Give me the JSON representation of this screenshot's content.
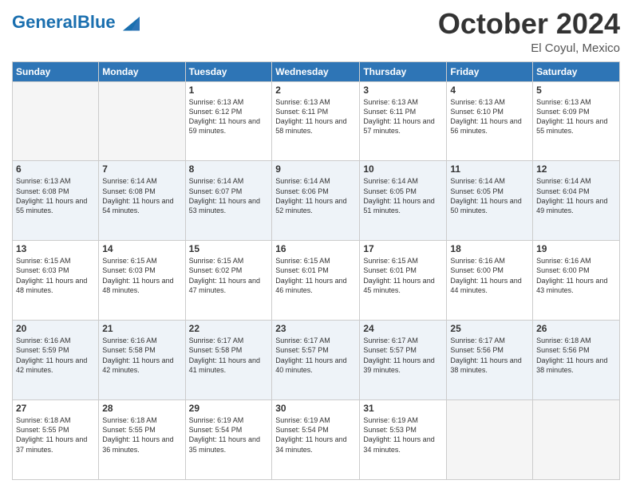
{
  "header": {
    "logo_text_general": "General",
    "logo_text_blue": "Blue",
    "month_title": "October 2024",
    "location": "El Coyul, Mexico"
  },
  "weekdays": [
    "Sunday",
    "Monday",
    "Tuesday",
    "Wednesday",
    "Thursday",
    "Friday",
    "Saturday"
  ],
  "weeks": [
    [
      {
        "day": "",
        "info": ""
      },
      {
        "day": "",
        "info": ""
      },
      {
        "day": "1",
        "info": "Sunrise: 6:13 AM\nSunset: 6:12 PM\nDaylight: 11 hours and 59 minutes."
      },
      {
        "day": "2",
        "info": "Sunrise: 6:13 AM\nSunset: 6:11 PM\nDaylight: 11 hours and 58 minutes."
      },
      {
        "day": "3",
        "info": "Sunrise: 6:13 AM\nSunset: 6:11 PM\nDaylight: 11 hours and 57 minutes."
      },
      {
        "day": "4",
        "info": "Sunrise: 6:13 AM\nSunset: 6:10 PM\nDaylight: 11 hours and 56 minutes."
      },
      {
        "day": "5",
        "info": "Sunrise: 6:13 AM\nSunset: 6:09 PM\nDaylight: 11 hours and 55 minutes."
      }
    ],
    [
      {
        "day": "6",
        "info": "Sunrise: 6:13 AM\nSunset: 6:08 PM\nDaylight: 11 hours and 55 minutes."
      },
      {
        "day": "7",
        "info": "Sunrise: 6:14 AM\nSunset: 6:08 PM\nDaylight: 11 hours and 54 minutes."
      },
      {
        "day": "8",
        "info": "Sunrise: 6:14 AM\nSunset: 6:07 PM\nDaylight: 11 hours and 53 minutes."
      },
      {
        "day": "9",
        "info": "Sunrise: 6:14 AM\nSunset: 6:06 PM\nDaylight: 11 hours and 52 minutes."
      },
      {
        "day": "10",
        "info": "Sunrise: 6:14 AM\nSunset: 6:05 PM\nDaylight: 11 hours and 51 minutes."
      },
      {
        "day": "11",
        "info": "Sunrise: 6:14 AM\nSunset: 6:05 PM\nDaylight: 11 hours and 50 minutes."
      },
      {
        "day": "12",
        "info": "Sunrise: 6:14 AM\nSunset: 6:04 PM\nDaylight: 11 hours and 49 minutes."
      }
    ],
    [
      {
        "day": "13",
        "info": "Sunrise: 6:15 AM\nSunset: 6:03 PM\nDaylight: 11 hours and 48 minutes."
      },
      {
        "day": "14",
        "info": "Sunrise: 6:15 AM\nSunset: 6:03 PM\nDaylight: 11 hours and 48 minutes."
      },
      {
        "day": "15",
        "info": "Sunrise: 6:15 AM\nSunset: 6:02 PM\nDaylight: 11 hours and 47 minutes."
      },
      {
        "day": "16",
        "info": "Sunrise: 6:15 AM\nSunset: 6:01 PM\nDaylight: 11 hours and 46 minutes."
      },
      {
        "day": "17",
        "info": "Sunrise: 6:15 AM\nSunset: 6:01 PM\nDaylight: 11 hours and 45 minutes."
      },
      {
        "day": "18",
        "info": "Sunrise: 6:16 AM\nSunset: 6:00 PM\nDaylight: 11 hours and 44 minutes."
      },
      {
        "day": "19",
        "info": "Sunrise: 6:16 AM\nSunset: 6:00 PM\nDaylight: 11 hours and 43 minutes."
      }
    ],
    [
      {
        "day": "20",
        "info": "Sunrise: 6:16 AM\nSunset: 5:59 PM\nDaylight: 11 hours and 42 minutes."
      },
      {
        "day": "21",
        "info": "Sunrise: 6:16 AM\nSunset: 5:58 PM\nDaylight: 11 hours and 42 minutes."
      },
      {
        "day": "22",
        "info": "Sunrise: 6:17 AM\nSunset: 5:58 PM\nDaylight: 11 hours and 41 minutes."
      },
      {
        "day": "23",
        "info": "Sunrise: 6:17 AM\nSunset: 5:57 PM\nDaylight: 11 hours and 40 minutes."
      },
      {
        "day": "24",
        "info": "Sunrise: 6:17 AM\nSunset: 5:57 PM\nDaylight: 11 hours and 39 minutes."
      },
      {
        "day": "25",
        "info": "Sunrise: 6:17 AM\nSunset: 5:56 PM\nDaylight: 11 hours and 38 minutes."
      },
      {
        "day": "26",
        "info": "Sunrise: 6:18 AM\nSunset: 5:56 PM\nDaylight: 11 hours and 38 minutes."
      }
    ],
    [
      {
        "day": "27",
        "info": "Sunrise: 6:18 AM\nSunset: 5:55 PM\nDaylight: 11 hours and 37 minutes."
      },
      {
        "day": "28",
        "info": "Sunrise: 6:18 AM\nSunset: 5:55 PM\nDaylight: 11 hours and 36 minutes."
      },
      {
        "day": "29",
        "info": "Sunrise: 6:19 AM\nSunset: 5:54 PM\nDaylight: 11 hours and 35 minutes."
      },
      {
        "day": "30",
        "info": "Sunrise: 6:19 AM\nSunset: 5:54 PM\nDaylight: 11 hours and 34 minutes."
      },
      {
        "day": "31",
        "info": "Sunrise: 6:19 AM\nSunset: 5:53 PM\nDaylight: 11 hours and 34 minutes."
      },
      {
        "day": "",
        "info": ""
      },
      {
        "day": "",
        "info": ""
      }
    ]
  ]
}
